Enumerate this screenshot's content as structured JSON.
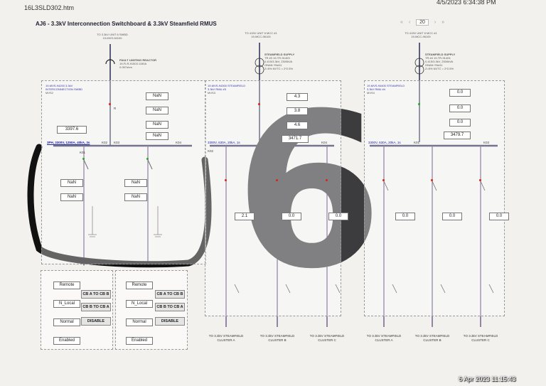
{
  "window": {
    "filename": "16L3SLD302.htm",
    "timestamp": "4/5/2023 6:34:38 PM"
  },
  "toolbar": {
    "page_number": "20",
    "nav_prev": "‹",
    "nav_next": "›",
    "first": "«",
    "last": "»"
  },
  "page_title": "AJ6 - 3.3kV Interconnection Switchboard & 3.3kV Steamfield RMUS",
  "photo_stamp": "6 Apr 2023 11:15:43",
  "overlay_number": "6",
  "switchboard": {
    "feed_label": "TO 3.3kV UNIT 6 SWBD",
    "feed_tag": "19-MVS-94100",
    "reactor_label": "FAULT LIMITING REACTOR",
    "reactor_spec": "19-FLR-91503 1150A",
    "reactor_ohm": "0.057ohm",
    "panel_title": "19-MVS-94200 3.3kV INTERCONNECTION SWBD",
    "panel_sub": "MVS2",
    "busbar_spec": "3PH, 3300V, 1250A, 40kA, 3s",
    "k_labels": [
      "K01",
      "K02",
      "K03",
      "K04"
    ],
    "main_value": "3397.6",
    "main_values_right": [
      "NaN",
      "NaN",
      "NaN",
      "NaN"
    ],
    "left_feeder_values": [
      "NaN",
      "NaN"
    ],
    "right_feeder_values": [
      "NaN",
      "NaN"
    ],
    "r_label": "R"
  },
  "controls": [
    {
      "mode": "Remote",
      "local": "N_Local",
      "normal": "Normal",
      "enabled": "Enabled",
      "btn1": "CB A TO CB B",
      "btn2": "CB B TO CB A",
      "btn3": "DISABLE"
    },
    {
      "mode": "Remote",
      "local": "N_Local",
      "normal": "Normal",
      "enabled": "Enabled",
      "btn1": "CB A TO CB B",
      "btn2": "CB B TO CB A",
      "btn3": "DISABLE"
    }
  ],
  "rmu3": {
    "feed_label": "TO 415V UNIT 6 MCC #1",
    "feed_tag": "19-MCC-96100",
    "supply_label": "STEAMFIELD SUPPLY",
    "supply_spec": "TR #3 19-TR-91403",
    "supply_rating": "0.415/3.3kV, 2300kVA",
    "supply_imp": "ONAN YNd11",
    "supply_tap": "Z=5% NVTC = 2*2.5%",
    "panel_title": "19-MVS-94300 STEAMFIELD 3.3kV RMU #3",
    "panel_sub": "MVS3",
    "values": [
      "4.3",
      "3.8",
      "4.6",
      "3471.7"
    ],
    "busbar_spec": "3300V, 630A, 20kA, 1s",
    "k_labels": [
      "K02",
      "K04"
    ],
    "feeder_values": [
      "2.1",
      "0.0",
      "0.0"
    ],
    "clusters": [
      "TO 3.3kV STEAMFIELD CLUSTER A",
      "TO 3.3kV STEAMFIELD CLUSTER B",
      "TO 3.3kV STEAMFIELD CLUSTER C"
    ]
  },
  "rmu4": {
    "feed_label": "TO 415V UNIT 6 MCC #1",
    "feed_tag": "19-MCC-96100",
    "supply_label": "STEAMFIELD SUPPLY",
    "supply_spec": "TR #4 19-TR-91404",
    "supply_rating": "0.415/3.3kV, 2300kVA",
    "supply_imp": "ONAN YNd11",
    "supply_tap": "Z=5% NVTC = 2*2.5%",
    "panel_title": "19-MVS-94400 STEAMFIELD 3.3kV RMU #4",
    "panel_sub": "MVS4",
    "values": [
      "0.0",
      "0.0",
      "0.0",
      "3479.7"
    ],
    "busbar_spec": "3300V, 630A, 20kA, 1s",
    "k_labels": [
      "K01",
      "K03"
    ],
    "feeder_values": [
      "0.0",
      "0.0",
      "0.0"
    ],
    "clusters": [
      "TO 3.3kV STEAMFIELD CLUSTER A",
      "TO 3.3kV STEAMFIELD CLUSTER B",
      "TO 3.3kV STEAMFIELD CLUSTER C"
    ]
  },
  "colors": {
    "bus": "#2a2a55",
    "feeder": "#5a3b7a",
    "breaker_red": "#d22",
    "breaker_green": "#2a2",
    "marker": "#111"
  }
}
